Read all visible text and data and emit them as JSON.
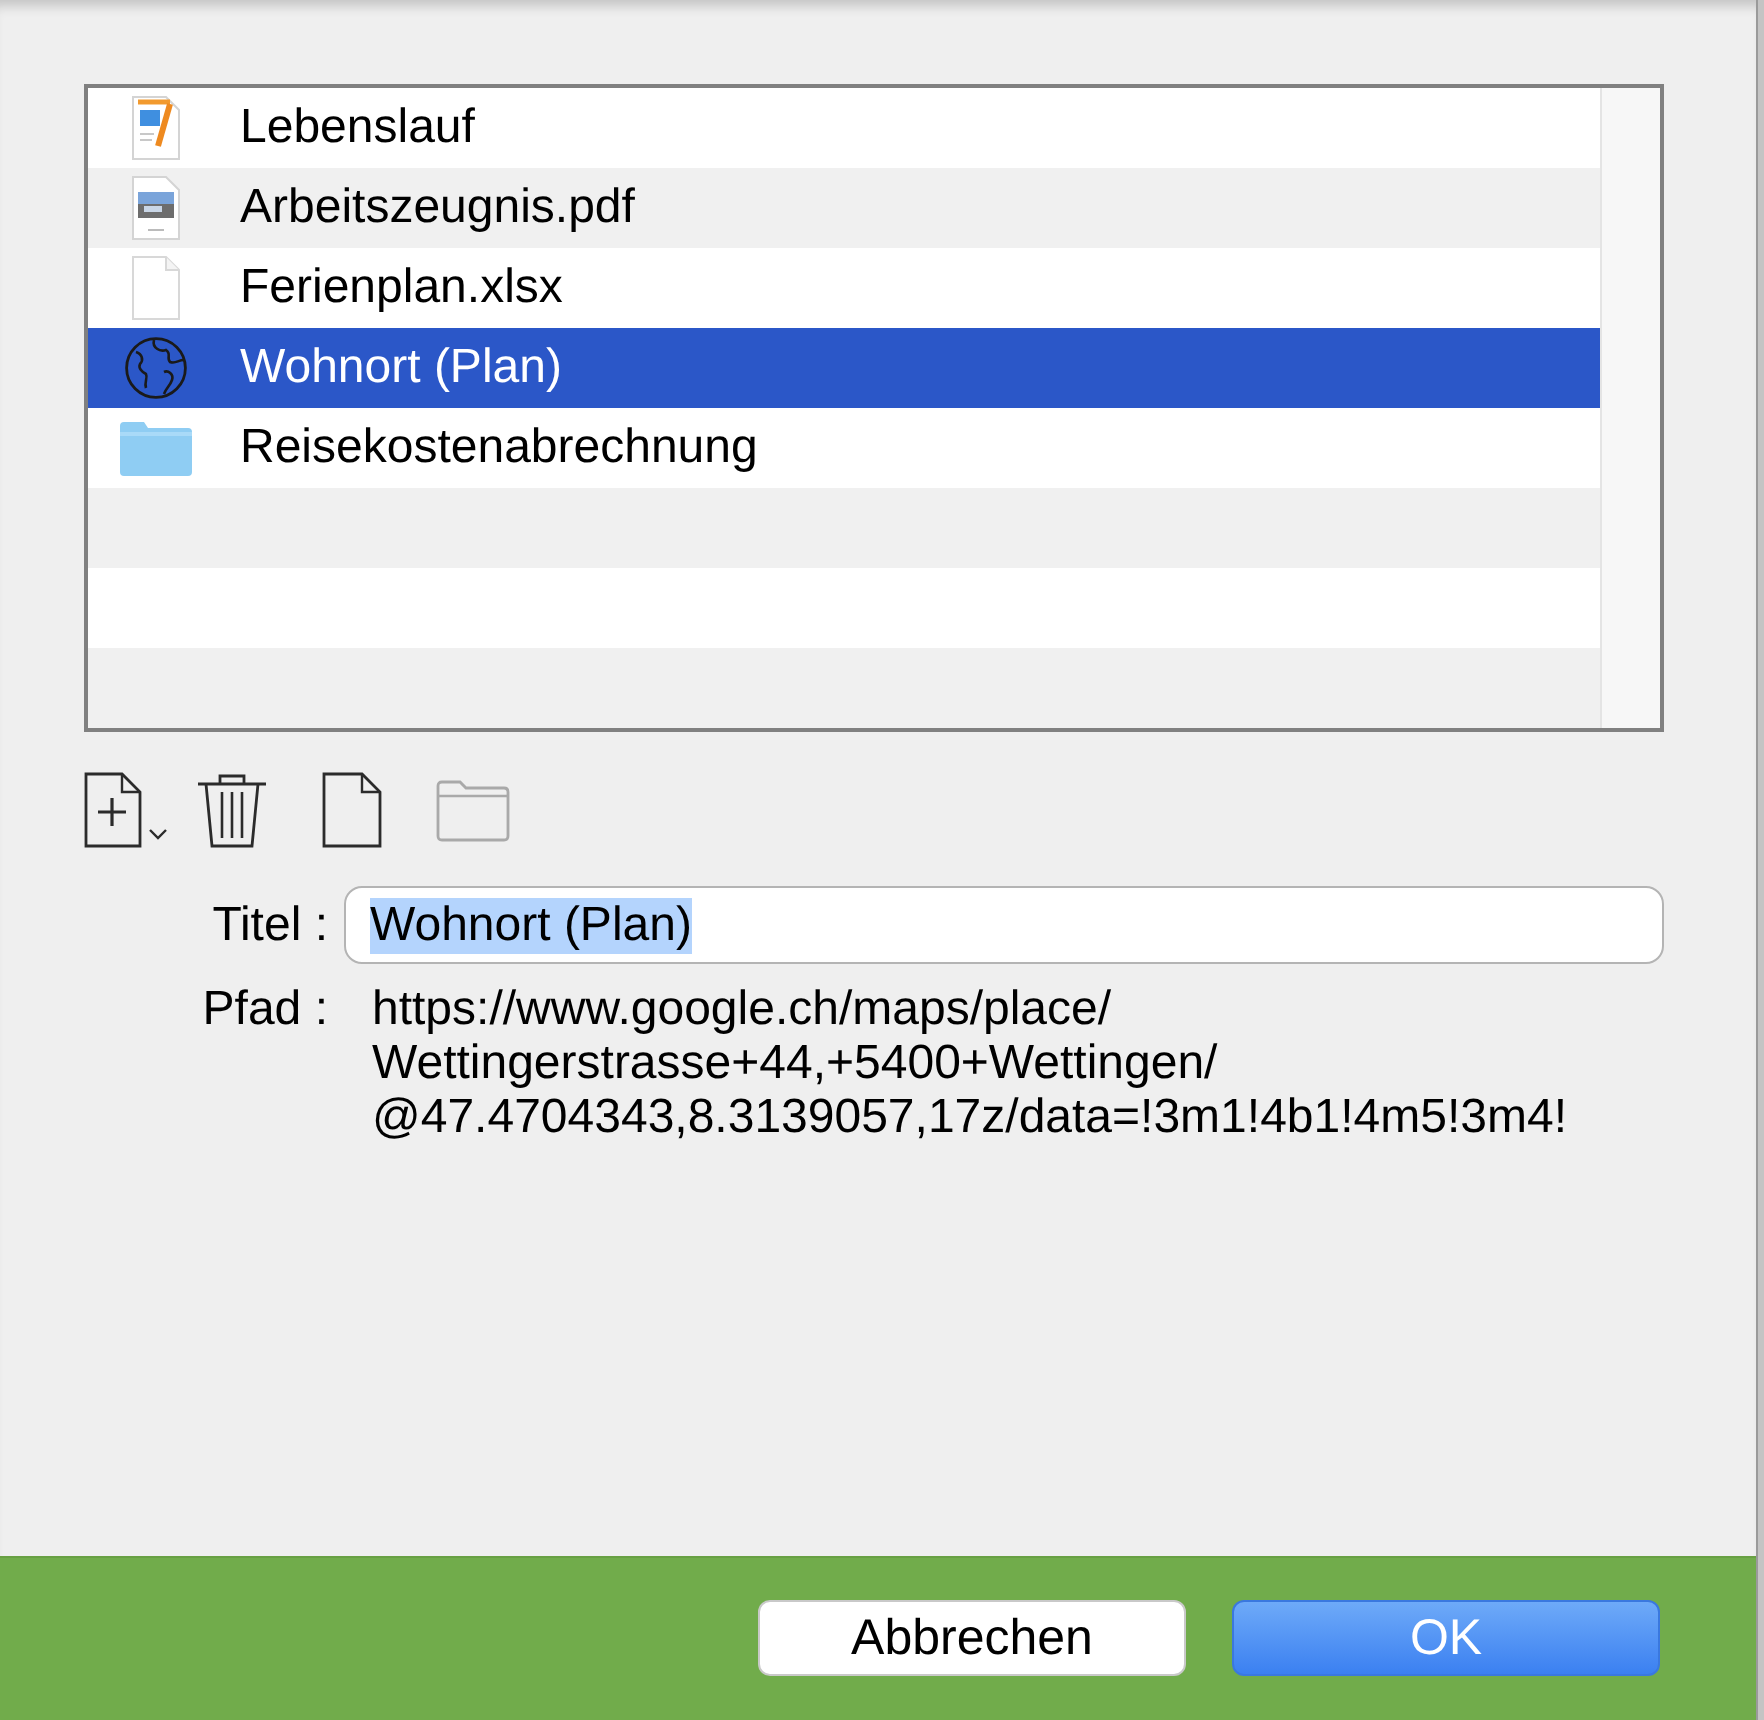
{
  "files": [
    {
      "name": "Lebenslauf",
      "kind": "illustrated",
      "selected": false
    },
    {
      "name": "Arbeitszeugnis.pdf",
      "kind": "image",
      "selected": false
    },
    {
      "name": "Ferienplan.xlsx",
      "kind": "blank",
      "selected": false
    },
    {
      "name": "Wohnort (Plan)",
      "kind": "web",
      "selected": true
    },
    {
      "name": "Reisekostenabrechnung",
      "kind": "folder",
      "selected": false
    }
  ],
  "toolbar": [
    {
      "kind": "add",
      "disabled": false
    },
    {
      "kind": "delete",
      "disabled": false
    },
    {
      "kind": "document",
      "disabled": false
    },
    {
      "kind": "folder",
      "disabled": true
    }
  ],
  "form": {
    "title_label": "Titel :",
    "title_value": "Wohnort (Plan)",
    "title_value_highlighted": true,
    "path_label": "Pfad :",
    "path_value": "https://www.google.ch/maps/place/Wettingerstrasse+44,+5400+Wettingen/@47.4704343,8.3139057,17z/data=!3m1!4b1!4m5!3m4!"
  },
  "buttons": [
    {
      "label": "Abbrechen",
      "kind": "secondary"
    },
    {
      "label": "OK",
      "kind": "primary"
    }
  ]
}
